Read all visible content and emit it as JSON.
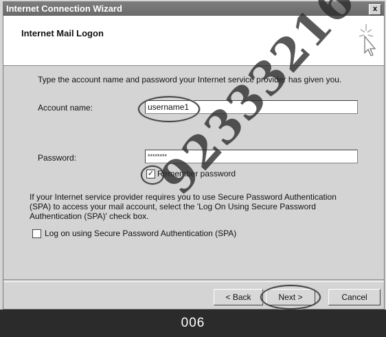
{
  "window": {
    "title": "Internet Connection Wizard",
    "close_glyph": "x"
  },
  "header": {
    "title": "Internet Mail Logon",
    "icon": "wizard-cursor-icon"
  },
  "intro": "Type the account name and password your Internet service provider has given you.",
  "account": {
    "label": "Account name:",
    "value": "username1"
  },
  "password": {
    "label": "Password:",
    "value": "********"
  },
  "remember": {
    "label": "Remember password",
    "checked": true
  },
  "spa_info": {
    "line1": "If your Internet service provider requires you to use Secure Password Authentication",
    "line2": "(SPA) to access your mail account, select the 'Log On Using Secure Password",
    "line3": "Authentication (SPA)' check box."
  },
  "spa": {
    "label": "Log on using Secure Password Authentication (SPA)",
    "checked": false
  },
  "buttons": {
    "back": "< Back",
    "next": "Next >",
    "cancel": "Cancel"
  },
  "footer": {
    "page_number": "006"
  },
  "watermark": "923332161"
}
